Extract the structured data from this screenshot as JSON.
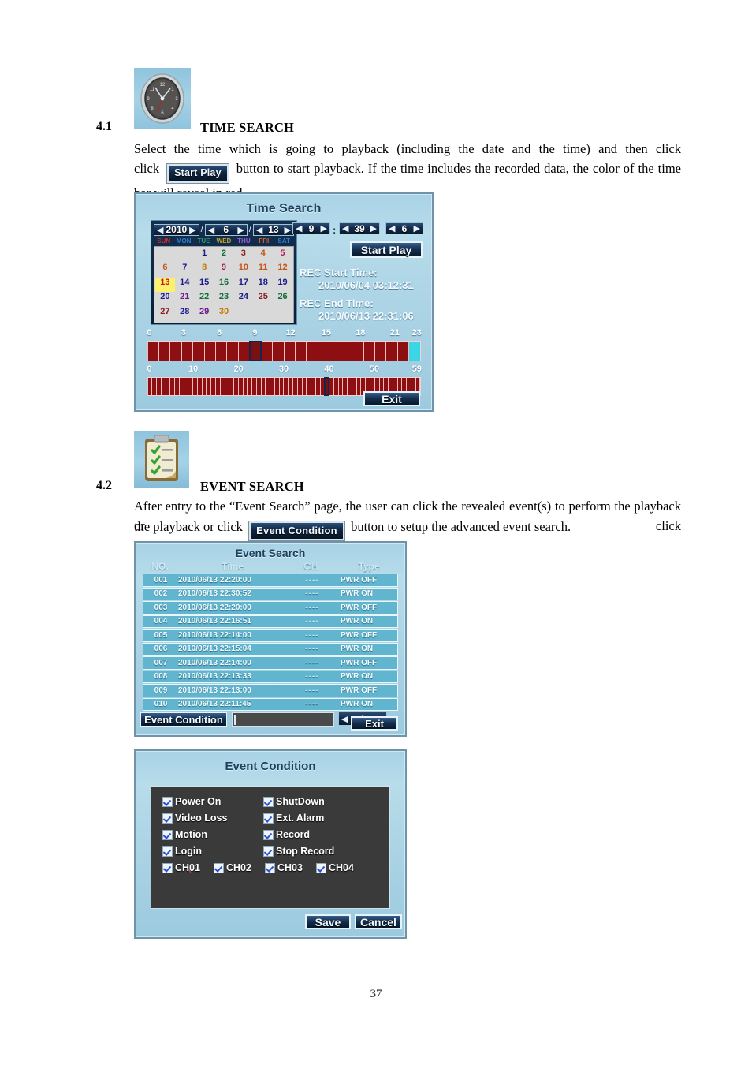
{
  "document": {
    "page_number": "37"
  },
  "section_time_search": {
    "number": "4.1",
    "title": "TIME SEARCH",
    "icon": "clock-icon",
    "paragraph_part1": "Select the time which is going to playback (including the date and the time) and then click",
    "inline_button": "Start Play",
    "paragraph_part2": "button to start playback. If the time includes the recorded data, the color of the time bar will reveal in red."
  },
  "section_event_search": {
    "number": "4.2",
    "title": "EVENT SEARCH",
    "icon": "clipboard-checklist-icon",
    "paragraph_part1": "After entry to the “Event Search” page, the user can click the revealed event(s) to perform the playback or click",
    "inline_button": "Event Condition",
    "paragraph_part2": "button to setup the advanced event search."
  },
  "time_search_dialog": {
    "title": "Time Search",
    "year": "2010",
    "month": "6",
    "day": "13",
    "date_sep1": "/",
    "date_sep2": "/",
    "hour": "9",
    "minute": "39",
    "second": "6",
    "time_sep1": ":",
    "arrow_left": "◀",
    "arrow_right": "▶",
    "start_play_label": "Start Play",
    "exit_label": "Exit",
    "rec_start_label": "REC Start Time:",
    "rec_start_value": "2010/06/04 03:12:31",
    "rec_end_label": "REC End Time:",
    "rec_end_value": "2010/06/13 22:31:06",
    "calendar": {
      "weekdays": [
        "SUN",
        "MON",
        "TUE",
        "WED",
        "THU",
        "FRI",
        "SAT"
      ],
      "weekday_colors": [
        "#d12a2a",
        "#2f7fd6",
        "#2f9c6f",
        "#c8a02a",
        "#9b5bd6",
        "#d1642a",
        "#2f7fd6"
      ],
      "leading_blanks": 2,
      "days": [
        1,
        2,
        3,
        4,
        5,
        6,
        7,
        8,
        9,
        10,
        11,
        12,
        13,
        14,
        15,
        16,
        17,
        18,
        19,
        20,
        21,
        22,
        23,
        24,
        25,
        26,
        27,
        28,
        29,
        30
      ],
      "selected_day": 13,
      "day_colors": [
        "#1a1a8c",
        "#116b3a",
        "#8c1a1a",
        "#c4561a",
        "#b01a5c",
        "#c4561a",
        "#1a1a8c",
        "#c47a00",
        "#b01a5c",
        "#c4561a",
        "#c4561a",
        "#c4561a",
        "#c41a1a",
        "#1a1a8c",
        "#1a1a8c",
        "#116b3a",
        "#1a1a8c",
        "#1a1a8c",
        "#1a1a8c",
        "#1a1a8c",
        "#6b1a8c",
        "#116b3a",
        "#116b3a",
        "#1a1a8c",
        "#8c1a1a",
        "#116b3a",
        "#8c1a1a",
        "#1a1a8c",
        "#6b1a8c",
        "#c47a00"
      ]
    },
    "hour_bar": {
      "ticks": [
        "0",
        "3",
        "6",
        "9",
        "12",
        "15",
        "18",
        "21",
        "23"
      ],
      "tick_positions_pct": [
        1,
        13.5,
        26.5,
        39.5,
        52.5,
        65.5,
        78,
        90.5,
        98.5
      ],
      "segments": 24,
      "recorded_through": 23,
      "empty_color": "#3bd6e4",
      "recorded_color": "#8e0f12",
      "cursor_index": 9
    },
    "minute_bar": {
      "ticks": [
        "0",
        "10",
        "20",
        "30",
        "40",
        "50",
        "59"
      ],
      "tick_positions_pct": [
        1,
        17,
        33.5,
        50,
        66.5,
        83,
        98.5
      ],
      "segments": 60,
      "recorded_color": "#8e0f12",
      "cursor_index": 39
    }
  },
  "event_search_dialog": {
    "title": "Event Search",
    "columns": [
      "NO.",
      "Time",
      "CH",
      "Type"
    ],
    "rows": [
      {
        "no": "001",
        "time": "2010/06/13 22:20:00",
        "ch": "----",
        "type": "PWR OFF"
      },
      {
        "no": "002",
        "time": "2010/06/13 22:30:52",
        "ch": "----",
        "type": "PWR ON"
      },
      {
        "no": "003",
        "time": "2010/06/13 22:20:00",
        "ch": "----",
        "type": "PWR OFF"
      },
      {
        "no": "004",
        "time": "2010/06/13 22:16:51",
        "ch": "----",
        "type": "PWR ON"
      },
      {
        "no": "005",
        "time": "2010/06/13 22:14:00",
        "ch": "----",
        "type": "PWR OFF"
      },
      {
        "no": "006",
        "time": "2010/06/13 22:15:04",
        "ch": "----",
        "type": "PWR ON"
      },
      {
        "no": "007",
        "time": "2010/06/13 22:14:00",
        "ch": "----",
        "type": "PWR OFF"
      },
      {
        "no": "008",
        "time": "2010/06/13 22:13:33",
        "ch": "----",
        "type": "PWR ON"
      },
      {
        "no": "009",
        "time": "2010/06/13 22:13:00",
        "ch": "----",
        "type": "PWR OFF"
      },
      {
        "no": "010",
        "time": "2010/06/13 22:11:45",
        "ch": "----",
        "type": "PWR ON"
      }
    ],
    "event_condition_label": "Event Condition",
    "page_value": "1",
    "arrow_left": "◀",
    "arrow_right": "▶",
    "exit_label": "Exit"
  },
  "event_condition_dialog": {
    "title": "Event Condition",
    "checkboxes_left": [
      "Power On",
      "Video Loss",
      "Motion",
      "Login"
    ],
    "checkboxes_right": [
      "ShutDown",
      "Ext. Alarm",
      "Record",
      "Stop Record"
    ],
    "channels": [
      "CH01",
      "CH02",
      "CH03",
      "CH04"
    ],
    "save_label": "Save",
    "cancel_label": "Cancel"
  }
}
